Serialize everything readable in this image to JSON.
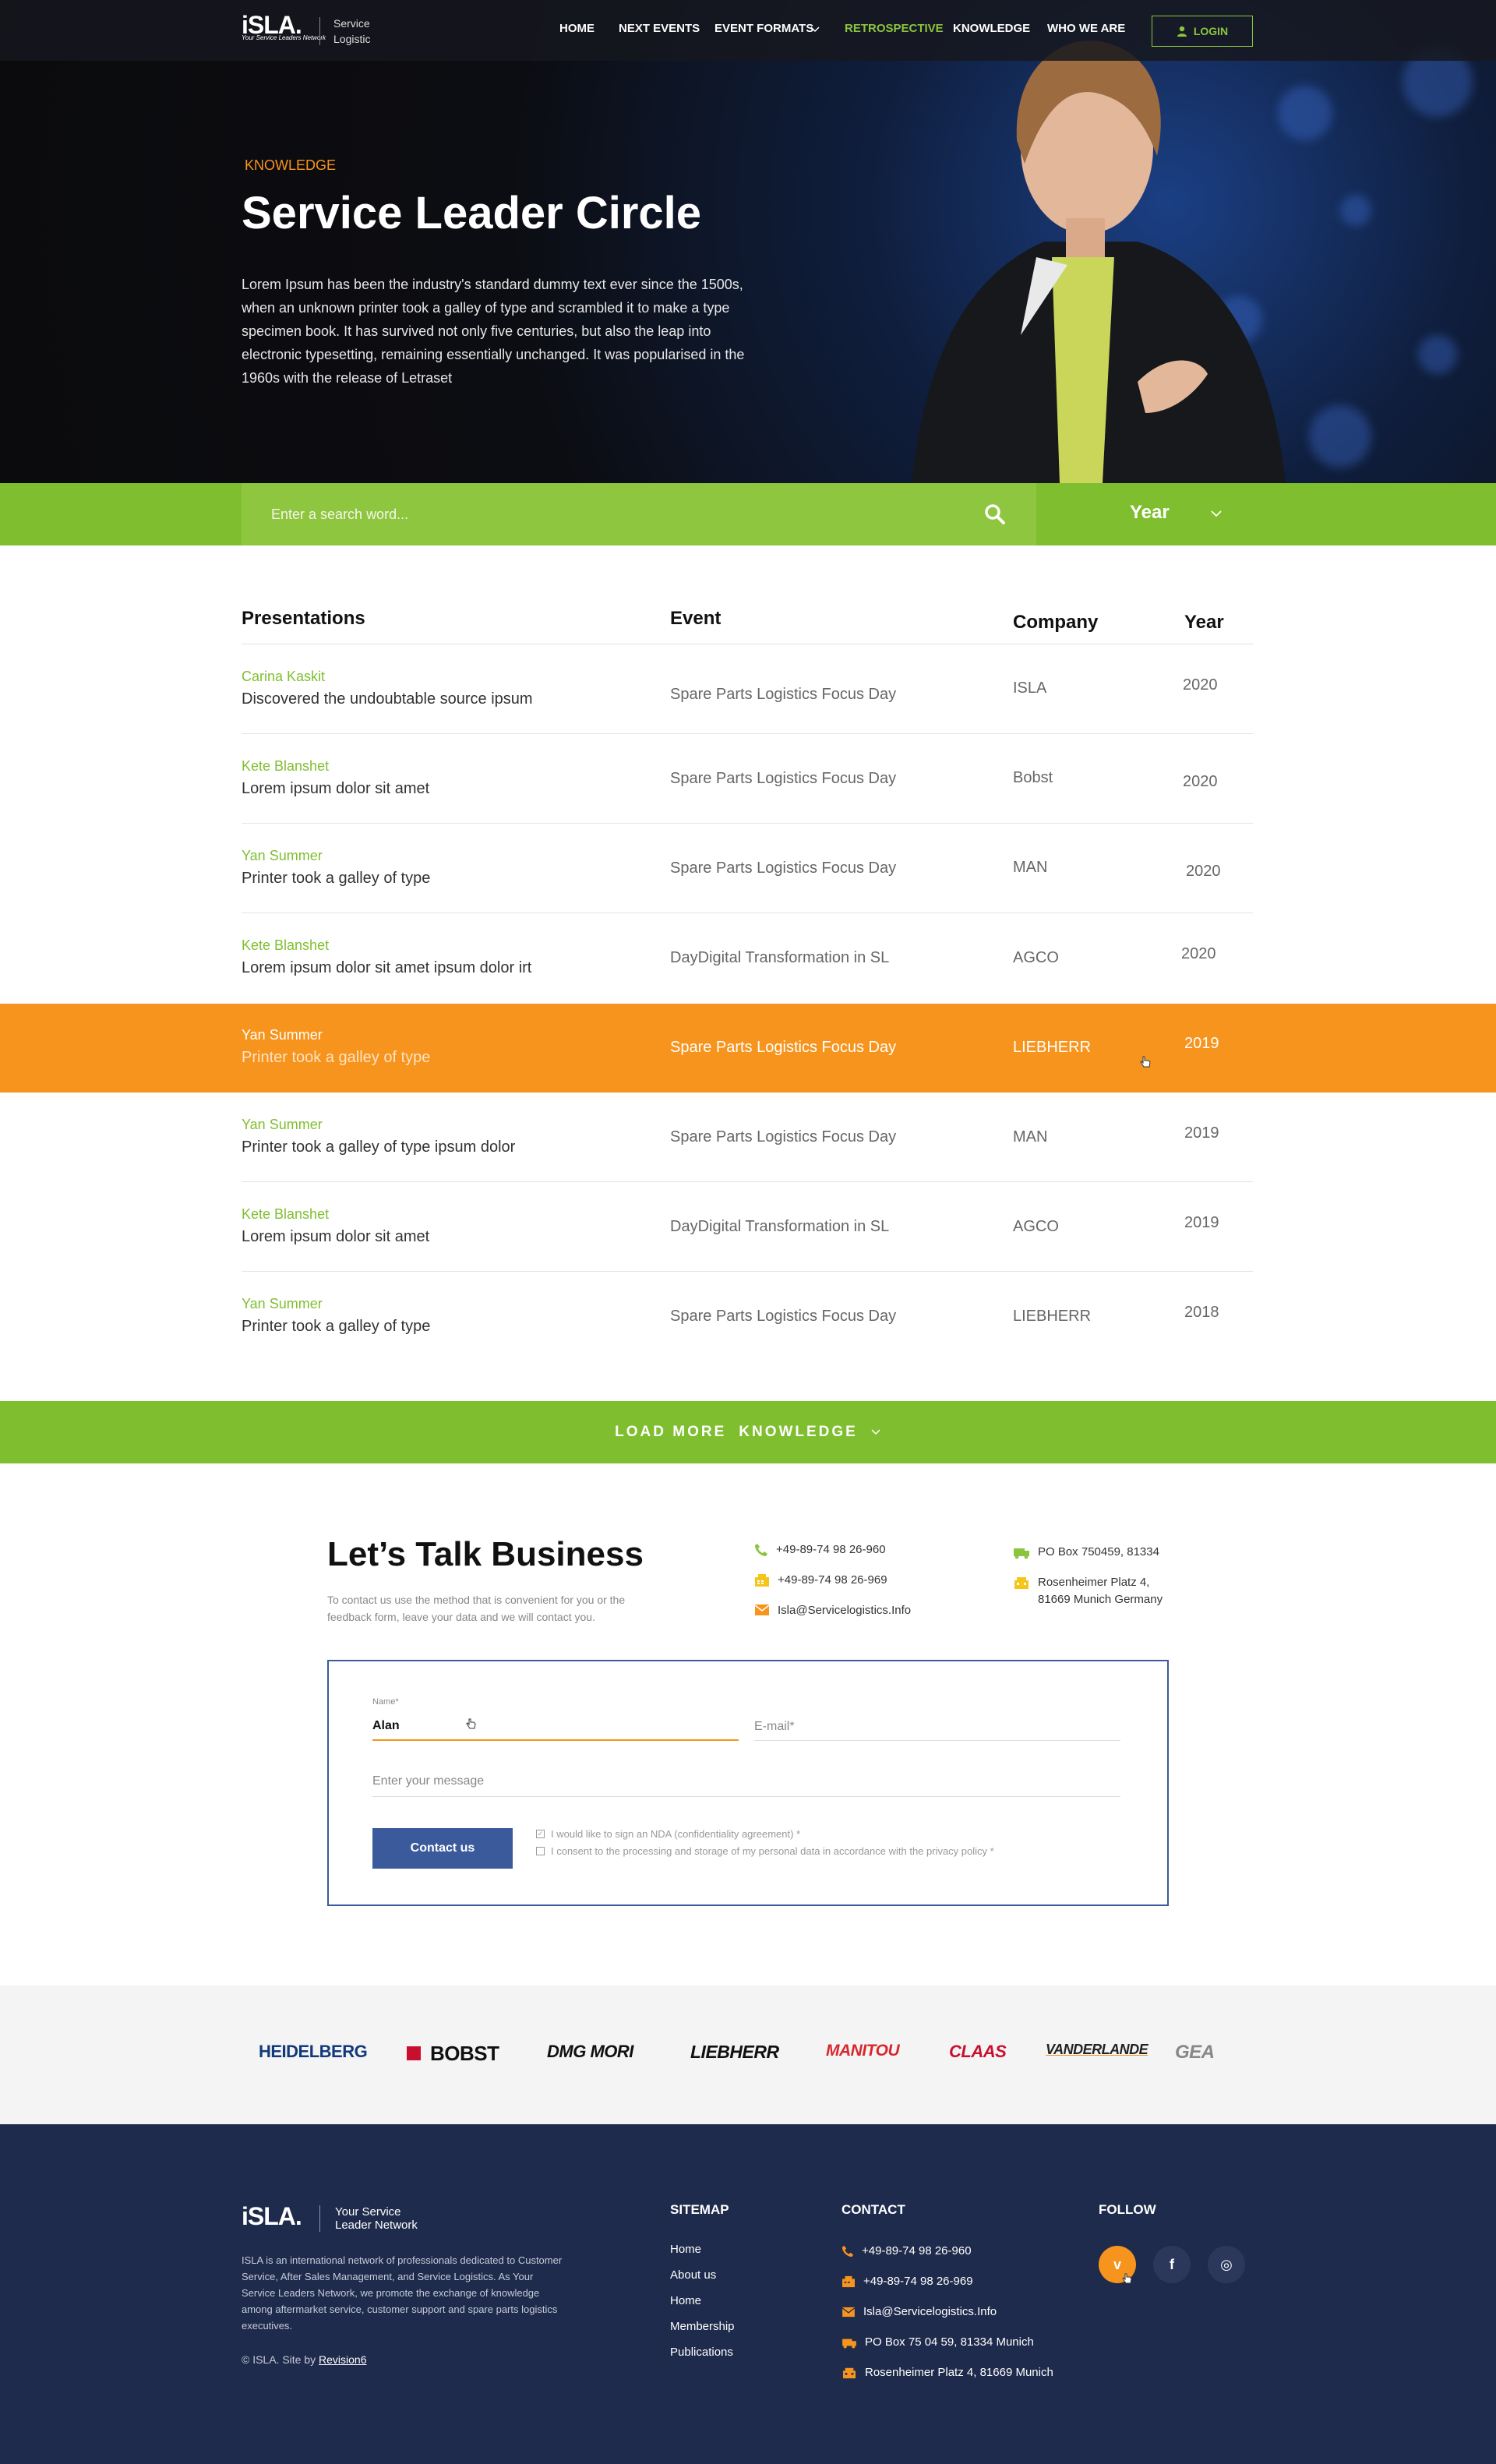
{
  "header": {
    "logo": "iSLA.",
    "logo_tagline": "Your Service Leaders Network",
    "logo_text_1": "Service",
    "logo_text_2": "Logistic",
    "nav": [
      {
        "label": "HOME"
      },
      {
        "label": "NEXT EVENTS"
      },
      {
        "label": "EVENT FORMATS"
      },
      {
        "label": "RETROSPECTIVE"
      },
      {
        "label": "KNOWLEDGE"
      },
      {
        "label": "WHO WE ARE"
      }
    ],
    "login_label": "LOGIN",
    "colors": {
      "accent_green": "#8bc53f",
      "accent_orange": "#f7941d",
      "navy": "#1f2b4c",
      "button_blue": "#3a5a9c"
    }
  },
  "hero": {
    "kicker": "KNOWLEDGE",
    "title": "Service Leader Circle",
    "text": "Lorem Ipsum has been the industry's standard dummy text ever since the 1500s, when an unknown printer took a galley of type and scrambled it to make a type specimen book. It has survived not only five centuries, but also the leap into electronic typesetting, remaining essentially unchanged. It was popularised in the 1960s with the release of Letraset"
  },
  "search": {
    "placeholder": "Enter a search word...",
    "icon": "search-icon",
    "year_label": "Year"
  },
  "table": {
    "headers": {
      "presentations": "Presentations",
      "event": "Event",
      "company": "Company",
      "year": "Year"
    },
    "rows": [
      {
        "author": "Carina Kaskit",
        "title": "Discovered the undoubtable source ipsum",
        "event": "Spare Parts Logistics Focus Day",
        "company": "ISLA",
        "year": "2020"
      },
      {
        "author": "Kete Blanshet",
        "title": "Lorem ipsum dolor sit amet",
        "event": "Spare Parts Logistics Focus Day",
        "company": "Bobst",
        "year": "2020"
      },
      {
        "author": "Yan Summer",
        "title": "Printer took a galley of type",
        "event": "Spare Parts Logistics Focus Day",
        "company": "MAN",
        "year": "2020"
      },
      {
        "author": "Kete Blanshet",
        "title": "Lorem ipsum dolor sit amet ipsum dolor irt",
        "event": "DayDigital Transformation in SL",
        "company": "AGCO",
        "year": "2020"
      },
      {
        "author": "Yan Summer",
        "title": "Printer took a galley of type",
        "event": "Spare Parts Logistics Focus Day",
        "company": "LIEBHERR",
        "year": "2019"
      },
      {
        "author": "Yan Summer",
        "title": "Printer took a galley of type ipsum dolor",
        "event": "Spare Parts Logistics Focus Day",
        "company": "MAN",
        "year": "2019"
      },
      {
        "author": "Kete Blanshet",
        "title": "Lorem ipsum dolor sit amet",
        "event": "DayDigital Transformation in SL",
        "company": "AGCO",
        "year": "2019"
      },
      {
        "author": "Yan Summer",
        "title": "Printer took a galley of type",
        "event": "Spare Parts Logistics Focus Day",
        "company": "LIEBHERR",
        "year": "2018"
      }
    ]
  },
  "load_more": {
    "label_1": "LOAD MORE",
    "label_2": "KNOWLEDGE"
  },
  "contact": {
    "title": "Let’s Talk Business",
    "subtitle": "To contact us use the method that is convenient for you or the feedback form, leave your data and we will contact you.",
    "phone": "+49-89-74 98 26-960",
    "fax": "+49-89-74 98 26-969",
    "email": "Isla@Servicelogistics.Info",
    "po_box": "PO Box 750459, 81334",
    "address_1": "Rosenheimer Platz 4,",
    "address_2": "81669 Munich Germany",
    "form": {
      "name_label": "Name*",
      "name_value": "Alan",
      "email_placeholder": "E-mail*",
      "message_placeholder": "Enter your message",
      "button": "Contact us",
      "nda": "I would like to sign an NDA (confidentiality agreement) *",
      "consent": "I consent to the processing and storage of my personal data in accordance with the privacy policy *"
    }
  },
  "brands": [
    "HEIDELBERG",
    "BOBST",
    "DMG MORI",
    "LIEBHERR",
    "MANITOU",
    "CLAAS",
    "VANDERLANDE",
    "GEA"
  ],
  "footer": {
    "logo": "iSLA.",
    "logo_text_1": "Your Service",
    "logo_text_2": "Leader Network",
    "about": "ISLA is an international network of professionals dedicated to Customer Service, After Sales Management, and Service Logistics. As Your Service Leaders Network, we promote the exchange of knowledge among aftermarket service, customer support and spare parts logistics executives.",
    "copyright": "© ISLA. Site by",
    "credit": "Revision6",
    "sitemap_title": "SITEMAP",
    "sitemap": [
      "Home",
      "About us",
      "Home",
      "Membership",
      "Publications"
    ],
    "contact_title": "CONTACT",
    "phone": "+49-89-74 98 26-960",
    "fax": "+49-89-74 98 26-969",
    "email": "Isla@Servicelogistics.Info",
    "po_box": "PO Box 75 04 59, 81334 Munich",
    "address": "Rosenheimer Platz 4, 81669 Munich",
    "follow_title": "FOLLOW",
    "social": [
      {
        "icon": "vimeo-icon",
        "glyph": "v"
      },
      {
        "icon": "facebook-icon",
        "glyph": "f"
      },
      {
        "icon": "instagram-icon",
        "glyph": "◎"
      }
    ]
  }
}
